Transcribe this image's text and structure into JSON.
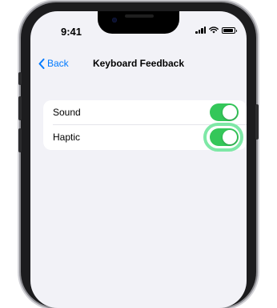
{
  "status_bar": {
    "time": "9:41"
  },
  "nav": {
    "back_label": "Back",
    "title": "Keyboard Feedback"
  },
  "settings": [
    {
      "label": "Sound",
      "enabled": true
    },
    {
      "label": "Haptic",
      "enabled": true,
      "highlighted": true
    }
  ],
  "colors": {
    "accent": "#007aff",
    "toggle_on": "#34c759",
    "highlight": "#7ee8a6",
    "background": "#f2f2f7"
  },
  "icons": [
    "chevron-left-icon",
    "signal-icon",
    "wifi-icon",
    "battery-icon"
  ]
}
